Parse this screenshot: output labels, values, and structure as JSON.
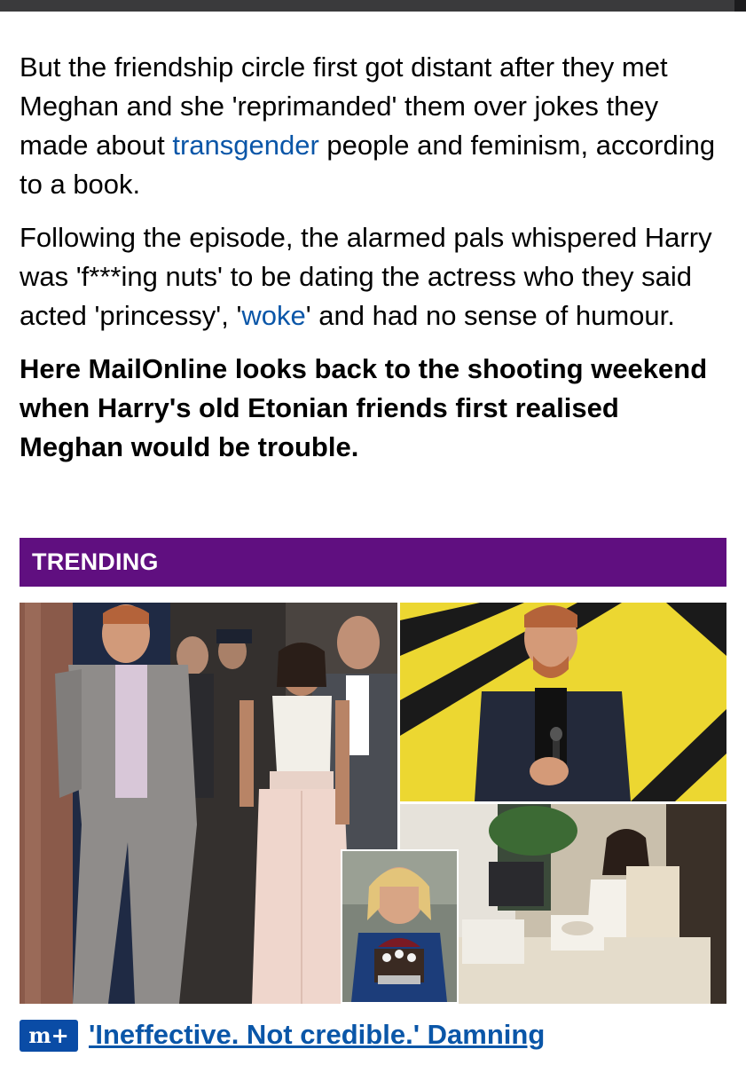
{
  "article": {
    "paragraph1": {
      "before_link": "But the friendship circle first got distant after they met Meghan and she 'reprimanded' them over jokes they made about ",
      "link": "transgender",
      "after_link": " people and feminism, according to a book."
    },
    "paragraph2": {
      "before_link": "Following the episode, the alarmed pals whispered Harry was 'f***ing nuts' to be dating the actress who they said acted 'princessy', '",
      "link": "woke",
      "after_link": "' and had no sense of humour."
    },
    "lead": "Here MailOnline looks back to the shooting weekend when Harry's old Etonian friends first realised Meghan would be trouble."
  },
  "trending": {
    "label": "TRENDING",
    "badge_text": "m+",
    "headline": "'Ineffective. Not credible.' Damning",
    "colors": {
      "banner": "#600f80",
      "link": "#0a56a8",
      "badge": "#0a4ca6"
    }
  }
}
